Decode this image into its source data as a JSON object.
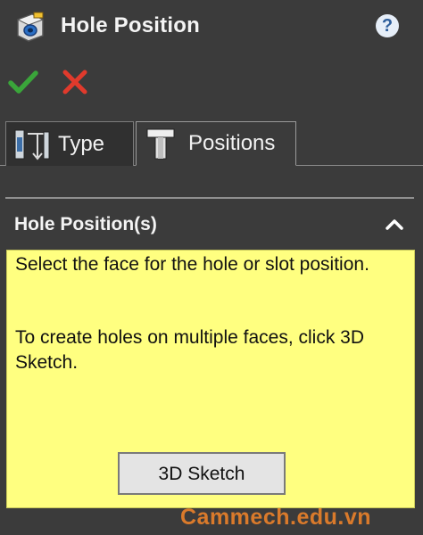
{
  "header": {
    "title": "Hole Position",
    "help_glyph": "?",
    "app_icon": "hole-wizard-icon"
  },
  "actions": {
    "ok_icon": "checkmark-icon",
    "cancel_icon": "x-icon",
    "ok_color": "#3aa53a",
    "cancel_color": "#e03a2c"
  },
  "tabs": [
    {
      "label": "Type",
      "icon": "hole-type-icon",
      "active": false
    },
    {
      "label": "Positions",
      "icon": "hole-positions-icon",
      "active": true
    }
  ],
  "section": {
    "title": "Hole Position(s)",
    "collapse_icon": "chevron-up-icon",
    "message_line1": "Select the face for the hole or slot position.",
    "message_line2": "To create holes on multiple faces, click 3D Sketch.",
    "button_label": "3D Sketch",
    "message_bg": "#ffff80"
  },
  "watermark": {
    "text": "Cammech.edu.vn",
    "color": "#e8802a"
  }
}
